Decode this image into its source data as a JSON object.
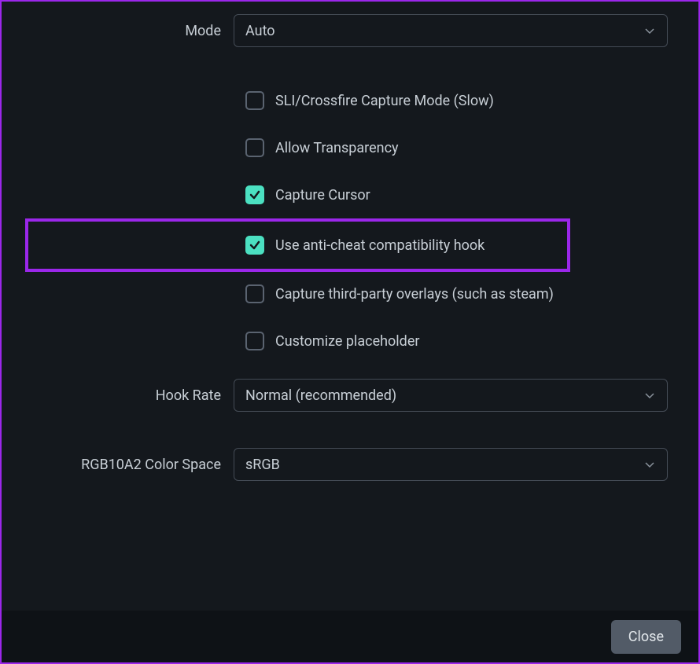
{
  "mode": {
    "label": "Mode",
    "value": "Auto"
  },
  "checkboxes": {
    "sli": {
      "label": "SLI/Crossfire Capture Mode (Slow)",
      "checked": false
    },
    "transparency": {
      "label": "Allow Transparency",
      "checked": false
    },
    "cursor": {
      "label": "Capture Cursor",
      "checked": true
    },
    "anticheat": {
      "label": "Use anti-cheat compatibility hook",
      "checked": true
    },
    "thirdparty": {
      "label": "Capture third-party overlays (such as steam)",
      "checked": false
    },
    "placeholder": {
      "label": "Customize placeholder",
      "checked": false
    }
  },
  "hook_rate": {
    "label": "Hook Rate",
    "value": "Normal (recommended)"
  },
  "color_space": {
    "label": "RGB10A2 Color Space",
    "value": "sRGB"
  },
  "footer": {
    "close": "Close"
  },
  "colors": {
    "accent": "#4be0c1",
    "highlight": "#9b27ea",
    "bg": "#14181d"
  }
}
